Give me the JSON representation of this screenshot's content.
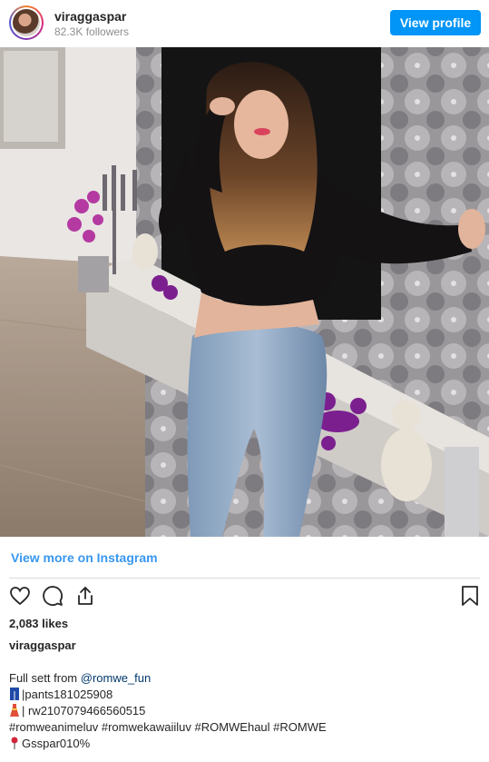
{
  "header": {
    "username": "viraggaspar",
    "followers": "82.3K followers",
    "view_profile": "View profile"
  },
  "view_more": "View more on Instagram",
  "likes": "2,083 likes",
  "author": "viraggaspar",
  "caption": {
    "line1_prefix": "Full sett from ",
    "line1_mention": "@romwe_fun",
    "line2": "|pants181025908",
    "line3": "| rw2107079466560515",
    "line4": "#romweanimeluv #romwekawaiiluv #ROMWEhaul #ROMWE",
    "line5": "Gsspar010%"
  },
  "icons": [
    "heart-icon",
    "comment-icon",
    "share-icon",
    "bookmark-icon",
    "jeans-emoji",
    "dress-emoji",
    "pin-emoji"
  ],
  "colors": {
    "accent": "#0095f6",
    "link": "#3897f0",
    "text": "#262626",
    "muted": "#8e8e8e"
  }
}
